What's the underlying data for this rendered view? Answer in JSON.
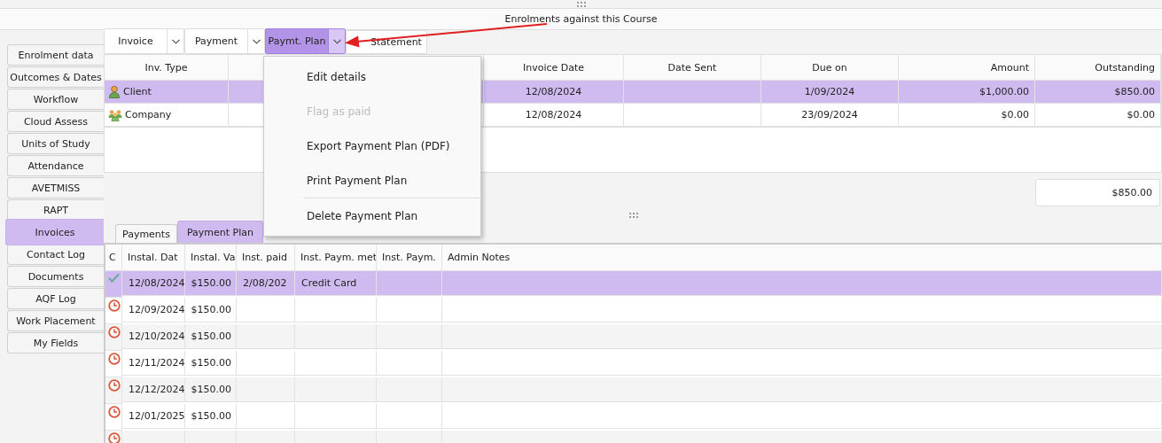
{
  "header": {
    "title": "Enrolments against this Course"
  },
  "sidebar": {
    "items": [
      {
        "label": "Enrolment data",
        "selected": false
      },
      {
        "label": "Outcomes & Dates",
        "selected": false
      },
      {
        "label": "Workflow",
        "selected": false
      },
      {
        "label": "Cloud Assess",
        "selected": false
      },
      {
        "label": "Units of Study",
        "selected": false
      },
      {
        "label": "Attendance",
        "selected": false
      },
      {
        "label": "AVETMISS",
        "selected": false
      },
      {
        "label": "RAPT",
        "selected": false
      },
      {
        "label": "Invoices",
        "selected": true
      },
      {
        "label": "Contact Log",
        "selected": false
      },
      {
        "label": "Documents",
        "selected": false
      },
      {
        "label": "AQF Log",
        "selected": false
      },
      {
        "label": "Work Placement",
        "selected": false
      },
      {
        "label": "My Fields",
        "selected": false
      }
    ]
  },
  "toolbar": [
    {
      "label": "Invoice",
      "kind": "split",
      "selected": false
    },
    {
      "label": "Payment",
      "kind": "split",
      "selected": false
    },
    {
      "label": "Paymt. Plan",
      "kind": "split",
      "selected": true
    },
    {
      "label": "Statement",
      "kind": "plain",
      "selected": false
    }
  ],
  "invoices": {
    "columns": [
      "Inv. Type",
      "",
      "",
      "Invoice Date",
      "Date Sent",
      "Due on",
      "Amount",
      "Outstanding"
    ],
    "rows": [
      {
        "kind": "client",
        "selected": true,
        "cells": [
          "Client",
          "",
          "",
          "12/08/2024",
          "",
          "1/09/2024",
          "$1,000.00",
          "$850.00"
        ]
      },
      {
        "kind": "company",
        "selected": false,
        "cells": [
          "Company",
          "",
          "",
          "12/08/2024",
          "",
          "23/09/2024",
          "$0.00",
          "$0.00"
        ]
      }
    ],
    "total": "$850.00"
  },
  "menu": {
    "items": [
      {
        "label": "Edit details",
        "disabled": false,
        "separator_before": false
      },
      {
        "label": "Flag as paid",
        "disabled": true,
        "separator_before": false
      },
      {
        "label": "Export Payment Plan (PDF)",
        "disabled": false,
        "separator_before": false
      },
      {
        "label": "Print Payment Plan",
        "disabled": false,
        "separator_before": false
      },
      {
        "label": "Delete Payment Plan",
        "disabled": false,
        "separator_before": true
      }
    ]
  },
  "tabs": [
    {
      "label": "Payments",
      "selected": false
    },
    {
      "label": "Payment Plan",
      "selected": true
    }
  ],
  "plan": {
    "columns": [
      "C",
      "Instal. Dat",
      "Instal. Va",
      "Inst. paid",
      "Inst. Paym. met",
      "Inst. Paym.",
      "Admin Notes"
    ],
    "rows": [
      {
        "kind": "paid",
        "selected": true,
        "cells": [
          "",
          "12/08/2024",
          "$150.00",
          "2/08/202",
          "Credit Card",
          "",
          ""
        ]
      },
      {
        "kind": "pending",
        "selected": false,
        "cells": [
          "",
          "12/09/2024",
          "$150.00",
          "",
          "",
          "",
          ""
        ]
      },
      {
        "kind": "pending",
        "selected": false,
        "cells": [
          "",
          "12/10/2024",
          "$150.00",
          "",
          "",
          "",
          ""
        ]
      },
      {
        "kind": "pending",
        "selected": false,
        "cells": [
          "",
          "12/11/2024",
          "$150.00",
          "",
          "",
          "",
          ""
        ]
      },
      {
        "kind": "pending",
        "selected": false,
        "cells": [
          "",
          "12/12/2024",
          "$150.00",
          "",
          "",
          "",
          ""
        ]
      },
      {
        "kind": "pending",
        "selected": false,
        "cells": [
          "",
          "12/01/2025",
          "$150.00",
          "",
          "",
          "",
          ""
        ]
      },
      {
        "kind": "pending",
        "selected": false,
        "cells": [
          "",
          "",
          "",
          "",
          "",
          "",
          ""
        ]
      }
    ]
  }
}
